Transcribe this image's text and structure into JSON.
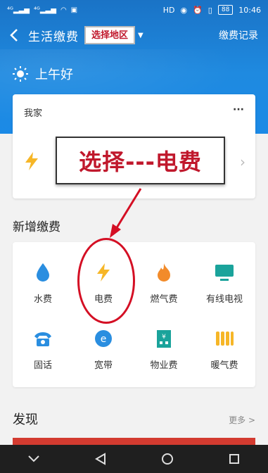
{
  "status_bar": {
    "left": [
      "4G",
      "4G",
      "wifi",
      "image"
    ],
    "time": "10:46",
    "battery": "88"
  },
  "topbar": {
    "title": "生活缴费",
    "region_tag": "选择地区",
    "records": "缴费记录"
  },
  "greeting": "上午好",
  "card": {
    "title": "我家",
    "more": "···",
    "callout": "选择---电费"
  },
  "section": {
    "title": "新增缴费",
    "items": [
      {
        "label": "水费",
        "icon": "water-drop-icon"
      },
      {
        "label": "电费",
        "icon": "lightning-icon"
      },
      {
        "label": "燃气费",
        "icon": "flame-icon"
      },
      {
        "label": "有线电视",
        "icon": "tv-icon"
      },
      {
        "label": "固话",
        "icon": "telephone-icon"
      },
      {
        "label": "宽带",
        "icon": "broadband-icon"
      },
      {
        "label": "物业费",
        "icon": "property-icon"
      },
      {
        "label": "暖气费",
        "icon": "heater-icon"
      }
    ]
  },
  "discover": {
    "title": "发现",
    "more": "更多 >"
  },
  "colors": {
    "header": "#1b7fd6",
    "accent_red": "#c0182c",
    "icon_blue": "#2a8ee0",
    "icon_teal": "#1aa39b",
    "icon_orange": "#f28b2a",
    "icon_yellow": "#f6b627"
  }
}
